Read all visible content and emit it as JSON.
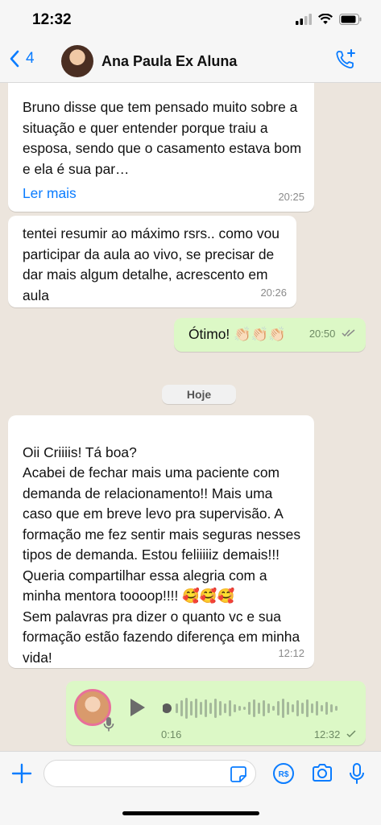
{
  "status": {
    "time": "12:32"
  },
  "header": {
    "back_count": "4",
    "contact_name": "Ana Paula Ex Aluna"
  },
  "messages": [
    {
      "direction": "in",
      "text": "Bruno disse que tem pensado muito sobre a situação e quer entender porque traiu a esposa, sendo que o casamento estava bom e ela é sua par…",
      "read_more": "Ler mais",
      "time": "20:25"
    },
    {
      "direction": "in",
      "text": "tentei resumir ao máximo rsrs.. como vou participar da aula ao vivo, se precisar de dar mais algum detalhe, acrescento em aula",
      "time": "20:26"
    },
    {
      "direction": "out",
      "text": "Ótimo! 👏🏻👏🏻👏🏻",
      "time": "20:50",
      "status": "read"
    },
    {
      "direction": "in",
      "text": "Oii Criiiis! Tá boa?\nAcabei de fechar mais uma paciente com demanda de relacionamento!! Mais uma caso que em breve levo pra supervisão. A formação me fez sentir mais seguras nesses tipos de demanda. Estou feliiiiiz demais!!! Queria compartilhar essa alegria com a minha mentora toooop!!!! 🥰🥰🥰\nSem palavras pra dizer o quanto vc e sua formação estão fazendo diferença em minha vida!",
      "time": "12:12"
    }
  ],
  "day_divider": "Hoje",
  "audio": {
    "duration": "0:16",
    "time": "12:32"
  },
  "colors": {
    "accent": "#0a7cff",
    "outgoing_bubble": "#dcf8c6",
    "incoming_bubble": "#ffffff",
    "chat_background": "#ece5dd"
  },
  "icons": {
    "back": "chevron-left-icon",
    "call": "add-call-icon",
    "play": "play-icon",
    "mic": "microphone-icon",
    "plus": "plus-icon",
    "sticker": "sticker-icon",
    "payment": "payment-icon",
    "camera": "camera-icon"
  }
}
